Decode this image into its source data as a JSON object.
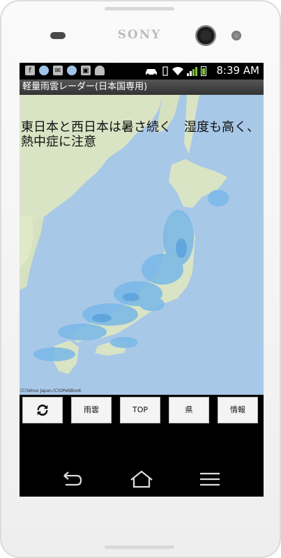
{
  "device": {
    "brand": "SONY"
  },
  "status_bar": {
    "time": "8:39 AM",
    "left_icons": [
      "facebook-icon",
      "globe-icon",
      "mail-icon",
      "globe-icon",
      "image-icon",
      "android-icon"
    ],
    "right_icons": [
      "car-icon",
      "vibrate-icon",
      "wifi-icon",
      "signal-icon",
      "battery-icon"
    ]
  },
  "app": {
    "title": "軽量雨雲レーダー(日本国専用)",
    "headline": "東日本と西日本は暑さ続く　湿度も高く、熱中症に注意",
    "map_credit": "(C)Yahoo Japan,(C)OPeNBooK"
  },
  "toolbar": {
    "refresh_icon": "refresh-icon",
    "buttons": [
      "雨雲",
      "TOP",
      "県",
      "情報"
    ]
  },
  "navigation": {
    "icons": [
      "back-icon",
      "home-icon",
      "recent-apps-icon"
    ]
  },
  "colors": {
    "sea": "#a8c8e8",
    "land": "#d9e4c4",
    "rain": "#78b8e8"
  }
}
